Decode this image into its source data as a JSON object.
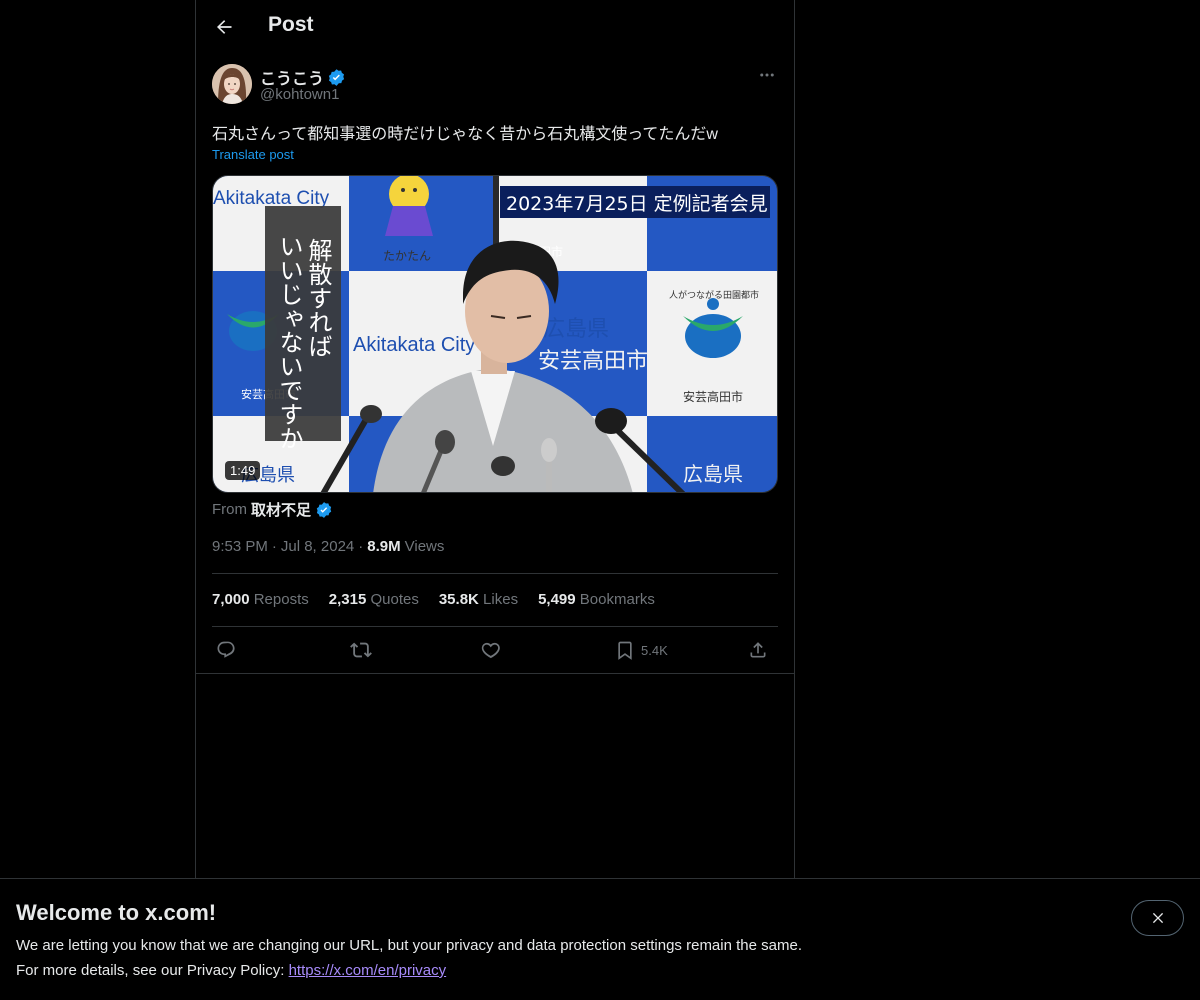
{
  "header": {
    "title": "Post",
    "back_icon": "arrow-left-icon"
  },
  "author": {
    "display_name": "こうこう",
    "handle": "@kohtown1",
    "verified": true,
    "verified_color": "#1d9bf0"
  },
  "tweet": {
    "text": "石丸さんって都知事選の時だけじゃなく昔から石丸構文使ってたんだw",
    "translate_label": "Translate post"
  },
  "media": {
    "duration": "1:49",
    "overlay_date_caption": "2023年7月25日 定例記者会見",
    "overlay_vertical_col1": "解散すれば",
    "overlay_vertical_col2": "いいじゃないですか",
    "backdrop_city_en": "Akitakata City",
    "backdrop_city_jp": "安芸高田市",
    "backdrop_pref_jp": "広島県",
    "backdrop_slogan": "人がつながる田園都市",
    "mascot_name": "たかたん"
  },
  "source": {
    "prefix": "From",
    "name": "取材不足",
    "verified": true
  },
  "meta": {
    "time": "9:53 PM",
    "separator": "·",
    "date": "Jul 8, 2024",
    "views_count": "8.9M",
    "views_label": "Views"
  },
  "stats": [
    {
      "count": "7,000",
      "label": "Reposts"
    },
    {
      "count": "2,315",
      "label": "Quotes"
    },
    {
      "count": "35.8K",
      "label": "Likes"
    },
    {
      "count": "5,499",
      "label": "Bookmarks"
    }
  ],
  "actions": {
    "reply_icon": "reply-icon",
    "repost_icon": "repost-icon",
    "like_icon": "heart-icon",
    "bookmark_icon": "bookmark-icon",
    "bookmark_count": "5.4K",
    "share_icon": "share-icon"
  },
  "banner": {
    "title": "Welcome to x.com!",
    "line1": "We are letting you know that we are changing our URL, but your privacy and data protection settings remain the same.",
    "line2_prefix": "For more details, see our Privacy Policy: ",
    "link": "https://x.com/en/privacy",
    "close_icon": "close-icon"
  },
  "colors": {
    "background": "#000000",
    "text_primary": "#e7e9ea",
    "text_secondary": "#71767b",
    "accent": "#1d9bf0",
    "border": "#2f3336",
    "link_visited": "#a78bfa"
  }
}
